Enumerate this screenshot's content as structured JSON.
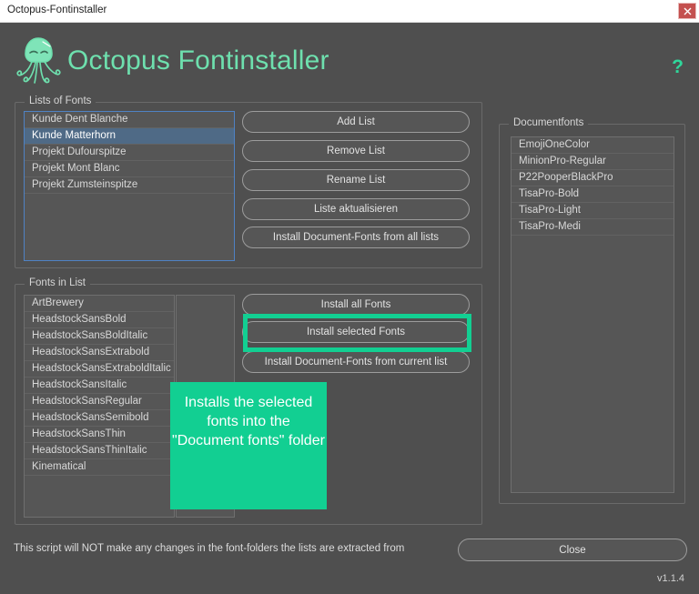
{
  "window": {
    "title": "Octopus-Fontinstaller",
    "close_icon": "close-icon"
  },
  "header": {
    "app_name": "Octopus Fontinstaller",
    "logo_icon": "octopus-logo-icon",
    "help_label": "?",
    "accent_color": "#2fd79b",
    "title_color": "#6ee0ae"
  },
  "lists_of_fonts": {
    "group_label": "Lists of Fonts",
    "items": [
      {
        "label": "Kunde Dent Blanche",
        "selected": false
      },
      {
        "label": "Kunde Matterhorn",
        "selected": true
      },
      {
        "label": "Projekt Dufourspitze",
        "selected": false
      },
      {
        "label": "Projekt Mont Blanc",
        "selected": false
      },
      {
        "label": "Projekt Zumsteinspitze",
        "selected": false
      }
    ],
    "buttons": {
      "add": "Add List",
      "remove": "Remove List",
      "rename": "Rename List",
      "update": "Liste aktualisieren",
      "install_all_lists": "Install Document-Fonts from all lists"
    }
  },
  "fonts_in_list": {
    "group_label": "Fonts in List",
    "items": [
      {
        "label": "ArtBrewery"
      },
      {
        "label": "HeadstockSansBold"
      },
      {
        "label": "HeadstockSansBoldItalic"
      },
      {
        "label": "HeadstockSansExtrabold"
      },
      {
        "label": "HeadstockSansExtraboldItalic"
      },
      {
        "label": "HeadstockSansItalic"
      },
      {
        "label": "HeadstockSansRegular"
      },
      {
        "label": "HeadstockSansSemibold"
      },
      {
        "label": "HeadstockSansThin"
      },
      {
        "label": "HeadstockSansThinItalic"
      },
      {
        "label": "Kinematical"
      }
    ],
    "second_column_items": [],
    "buttons": {
      "install_all": "Install all Fonts",
      "install_selected": "Install selected Fonts",
      "install_current_list": "Install Document-Fonts from current list"
    },
    "highlight_color": "#12cf92"
  },
  "tooltip": {
    "text": "Installs the selected fonts into the \"Document fonts\" folder",
    "background": "#12cf92"
  },
  "documentfonts": {
    "group_label": "Documentfonts",
    "items": [
      {
        "label": "EmojiOneColor"
      },
      {
        "label": "MinionPro-Regular"
      },
      {
        "label": "P22PooperBlackPro"
      },
      {
        "label": "TisaPro-Bold"
      },
      {
        "label": "TisaPro-Light"
      },
      {
        "label": "TisaPro-Medi"
      }
    ]
  },
  "footer": {
    "note": "This script will NOT make any changes in the font-folders the lists are extracted from",
    "close_label": "Close",
    "version": "v1.1.4"
  }
}
